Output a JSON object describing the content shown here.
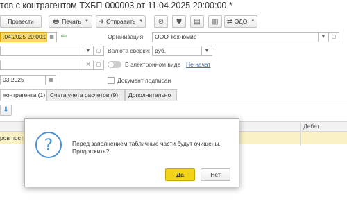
{
  "window": {
    "title": "тов с контрагентом ТХБП-000003 от 11.04.2025 20:00:00 *"
  },
  "toolbar": {
    "post_label": "Провести",
    "print_label": "Печать",
    "send_label": "Отправить",
    "edo_label": "ЭДО"
  },
  "form": {
    "date_value": ".04.2025 20:00:00",
    "org_label": "Организация:",
    "org_value": "ООО Техномир",
    "currency_label": "Валюта сверки:",
    "currency_value": "руб.",
    "electronic_label": "В электронном виде",
    "start_link": "Не начат",
    "date2_value": "03.2025",
    "doc_signed_label": "Документ подписан"
  },
  "tabs": [
    {
      "label": "контрагента (1)"
    },
    {
      "label": "Счета учета расчетов (9)"
    },
    {
      "label": "Дополнительно"
    }
  ],
  "table": {
    "debet_header": "Дебет",
    "row_text": "ров пост"
  },
  "dialog": {
    "message": "Перед заполнением табличные части будут очищены. Продолжить?",
    "yes_label": "Да",
    "no_label": "Нет"
  },
  "colors": {
    "accent_yellow": "#f3d319",
    "selected_field": "#f6da6b",
    "info_blue": "#4a90d9"
  }
}
